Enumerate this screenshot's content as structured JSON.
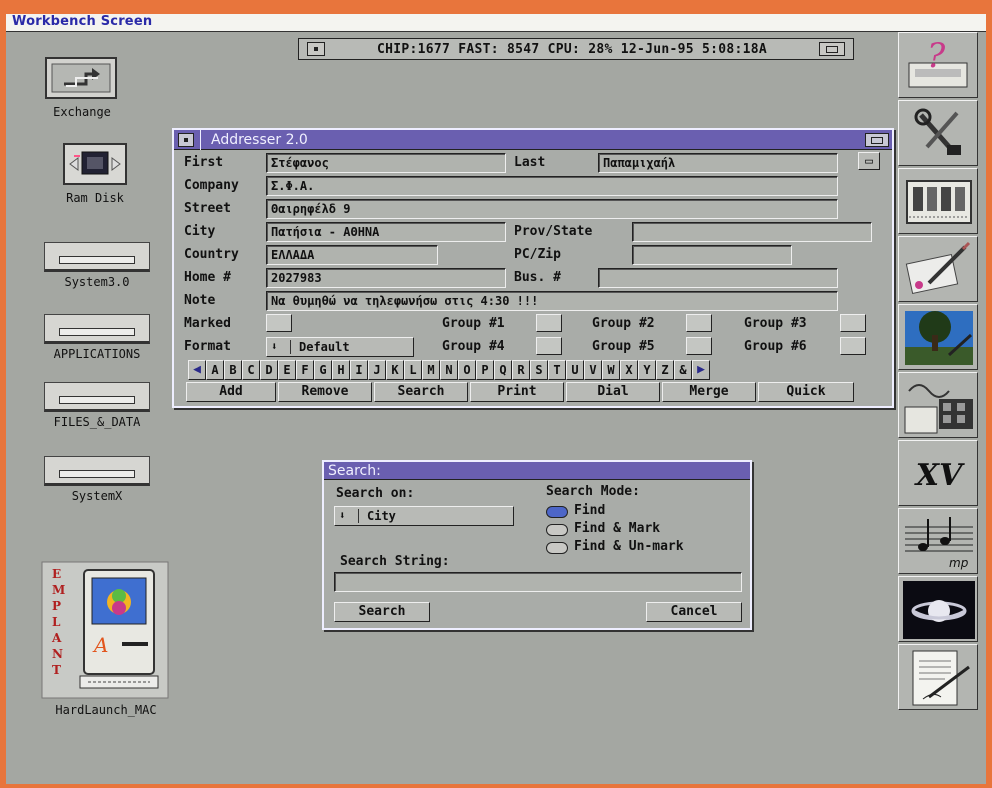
{
  "screen": {
    "title": "Workbench Screen",
    "status": "CHIP:1677 FAST: 8547 CPU: 28% 12-Jun-95  5:08:18A"
  },
  "desktop_icons": [
    {
      "label": "Exchange",
      "icon": "exchange-icon"
    },
    {
      "label": "Ram Disk",
      "icon": "ram-disk-icon"
    },
    {
      "label": "System3.0",
      "icon": "drawer-icon"
    },
    {
      "label": "APPLICATIONS",
      "icon": "drawer-icon"
    },
    {
      "label": "FILES_&_DATA",
      "icon": "drawer-icon"
    },
    {
      "label": "SystemX",
      "icon": "drawer-icon"
    },
    {
      "label": "HardLaunch_MAC",
      "icon": "emplant-mac-icon",
      "brand": "EMPLANT"
    }
  ],
  "addresser": {
    "title": "Addresser 2.0",
    "labels": {
      "first": "First",
      "last": "Last",
      "company": "Company",
      "street": "Street",
      "city": "City",
      "prov_state": "Prov/State",
      "country": "Country",
      "pc_zip": "PC/Zip",
      "home": "Home #",
      "bus": "Bus. #",
      "note": "Note",
      "marked": "Marked",
      "format": "Format",
      "group1": "Group #1",
      "group2": "Group #2",
      "group3": "Group #3",
      "group4": "Group #4",
      "group5": "Group #5",
      "group6": "Group #6"
    },
    "values": {
      "first": "Στέφανος",
      "last": "Παπαμιχαήλ",
      "company": "Σ.Φ.Α.",
      "street": "Θαιρηφέλδ 9",
      "city": "Πατήσια -  ΑΘΗΝΑ",
      "prov_state": "",
      "country": "ΕΛΛΑΔΑ",
      "pc_zip": "",
      "home": "2027983",
      "bus": "",
      "note": "Να θυμηθώ να τηλεφωνήσω στις 4:30 !!!",
      "format": "Default"
    },
    "alphabet": [
      "◀",
      "A",
      "B",
      "C",
      "D",
      "E",
      "F",
      "G",
      "H",
      "I",
      "J",
      "K",
      "L",
      "M",
      "N",
      "O",
      "P",
      "Q",
      "R",
      "S",
      "T",
      "U",
      "V",
      "W",
      "X",
      "Y",
      "Z",
      "&",
      "▶"
    ],
    "buttons": [
      {
        "label": "Add",
        "key": "A"
      },
      {
        "label": "Remove",
        "key": "R"
      },
      {
        "label": "Search",
        "key": "S"
      },
      {
        "label": "Print",
        "key": "P"
      },
      {
        "label": "Dial",
        "key": "D"
      },
      {
        "label": "Merge",
        "key": "M"
      },
      {
        "label": "Quick",
        "key": "Q"
      }
    ]
  },
  "search_dialog": {
    "title": "Search:",
    "search_on_label": "Search on:",
    "search_on_value": "City",
    "mode_label": "Search Mode:",
    "modes": [
      {
        "label": "Find",
        "selected": true
      },
      {
        "label": "Find & Mark",
        "selected": false
      },
      {
        "label": "Find & Un-mark",
        "selected": false
      }
    ],
    "string_label": "Search String:",
    "string_value": "",
    "search_button": "Search",
    "cancel_button": "Cancel"
  },
  "dock": [
    {
      "icon": "help-icon"
    },
    {
      "icon": "tools-icon"
    },
    {
      "icon": "spreadsheet-icon"
    },
    {
      "icon": "paint-icon"
    },
    {
      "icon": "tree-image-icon"
    },
    {
      "icon": "multimedia-icon"
    },
    {
      "icon": "xv-icon",
      "text": "XV"
    },
    {
      "icon": "music-icon",
      "text": "mp"
    },
    {
      "icon": "saturn-icon"
    },
    {
      "icon": "writer-icon"
    }
  ]
}
